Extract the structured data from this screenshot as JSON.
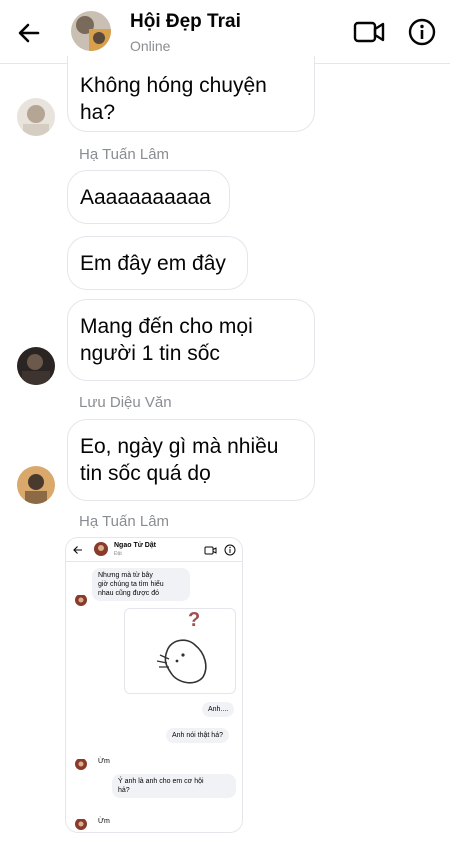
{
  "header": {
    "title": "Hội Đẹp Trai",
    "status": "Online"
  },
  "messages": [
    {
      "text_lines": [
        "Không hóng chuyện",
        "ha?"
      ]
    },
    {
      "sender": "Hạ Tuấn Lâm",
      "text": "Aaaaaaaaaaa"
    },
    {
      "text": "Em đây em đây"
    },
    {
      "text_lines": [
        "Mang đến cho mọi",
        "người 1 tin sốc"
      ]
    },
    {
      "sender": "Lưu Diệu Văn",
      "text_lines": [
        "Eo, ngày gì mà nhiều",
        "tin sốc quá dọ"
      ]
    },
    {
      "sender": "Hạ Tuấn Lâm"
    }
  ],
  "shared_screenshot": {
    "title": "Ngao Tử Dật",
    "status": "Đật",
    "msg1_lines": [
      "Nhưng mà từ bây",
      "giờ chúng ta tìm hiểu",
      "nhau cũng được đó"
    ],
    "sticker_mark": "?",
    "msg_anh": "Anh....",
    "msg_anh_noi": "Anh nói thật há?",
    "msg_um1": "Ừm",
    "msg_y_lines": [
      "Ý anh là anh cho em cơ hội",
      "hả?"
    ],
    "msg_um2": "Ừm"
  },
  "colors": {
    "bubble_border": "#e4e6eb",
    "secondary_text": "#8a8d91",
    "inner_bubble": "#f0f2f5"
  }
}
